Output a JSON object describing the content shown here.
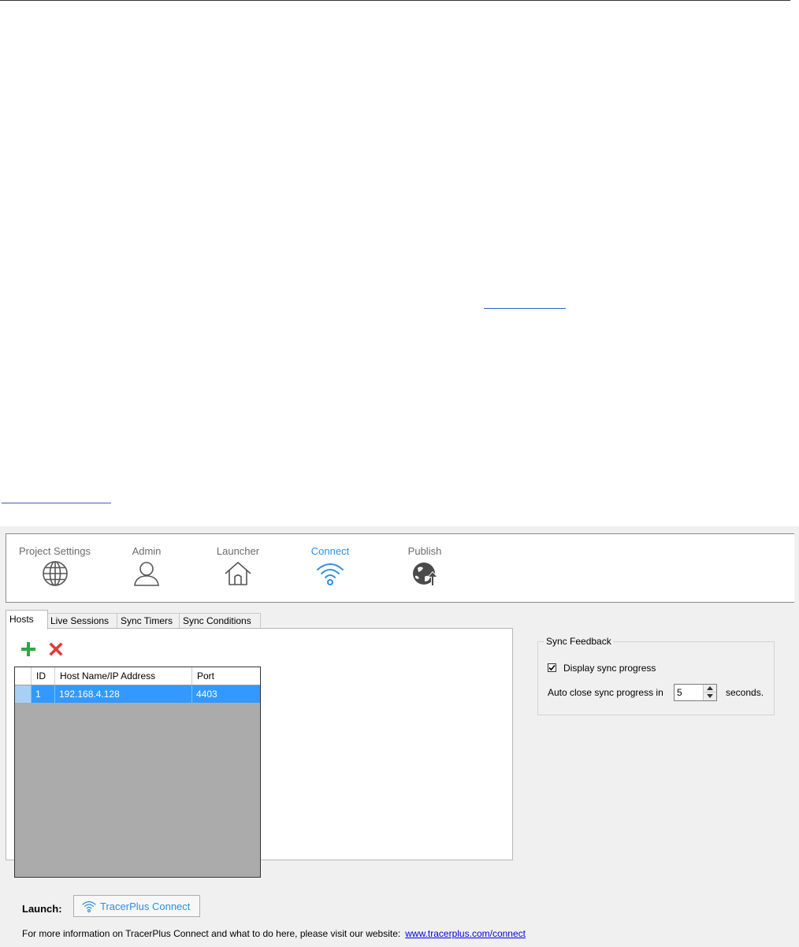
{
  "nav": {
    "items": [
      {
        "label": "Project Settings",
        "icon": "globe-icon"
      },
      {
        "label": "Admin",
        "icon": "user-icon"
      },
      {
        "label": "Launcher",
        "icon": "home-icon"
      },
      {
        "label": "Connect",
        "icon": "wifi-icon",
        "active": true
      },
      {
        "label": "Publish",
        "icon": "publish-globe-icon"
      }
    ],
    "accent_color": "#2e8ee0"
  },
  "tabs": [
    {
      "label": "Hosts",
      "active": true
    },
    {
      "label": "Live Sessions"
    },
    {
      "label": "Sync Timers"
    },
    {
      "label": "Sync Conditions"
    }
  ],
  "toolbar": {
    "add_icon": "plus-icon",
    "add_color": "#2aa84a",
    "delete_icon": "close-icon",
    "delete_color": "#e03b3b"
  },
  "hosts_grid": {
    "columns": [
      "ID",
      "Host Name/IP Address",
      "Port"
    ],
    "rows": [
      {
        "id": "1",
        "host": "192.168.4.128",
        "port": "4403"
      }
    ],
    "selected_row_color": "#3399ff"
  },
  "sync_feedback": {
    "title": "Sync Feedback",
    "display_progress_label": "Display sync progress",
    "display_progress_checked": true,
    "auto_close_label": "Auto close sync progress in",
    "auto_close_value": "5",
    "auto_close_suffix": "seconds."
  },
  "launch": {
    "label": "Launch:",
    "button_label": "TracerPlus Connect",
    "button_icon": "wifi-icon"
  },
  "info": {
    "text": "For more information on TracerPlus Connect and what to do here, please visit our website:",
    "link_text": "www.tracerplus.com/connect"
  }
}
